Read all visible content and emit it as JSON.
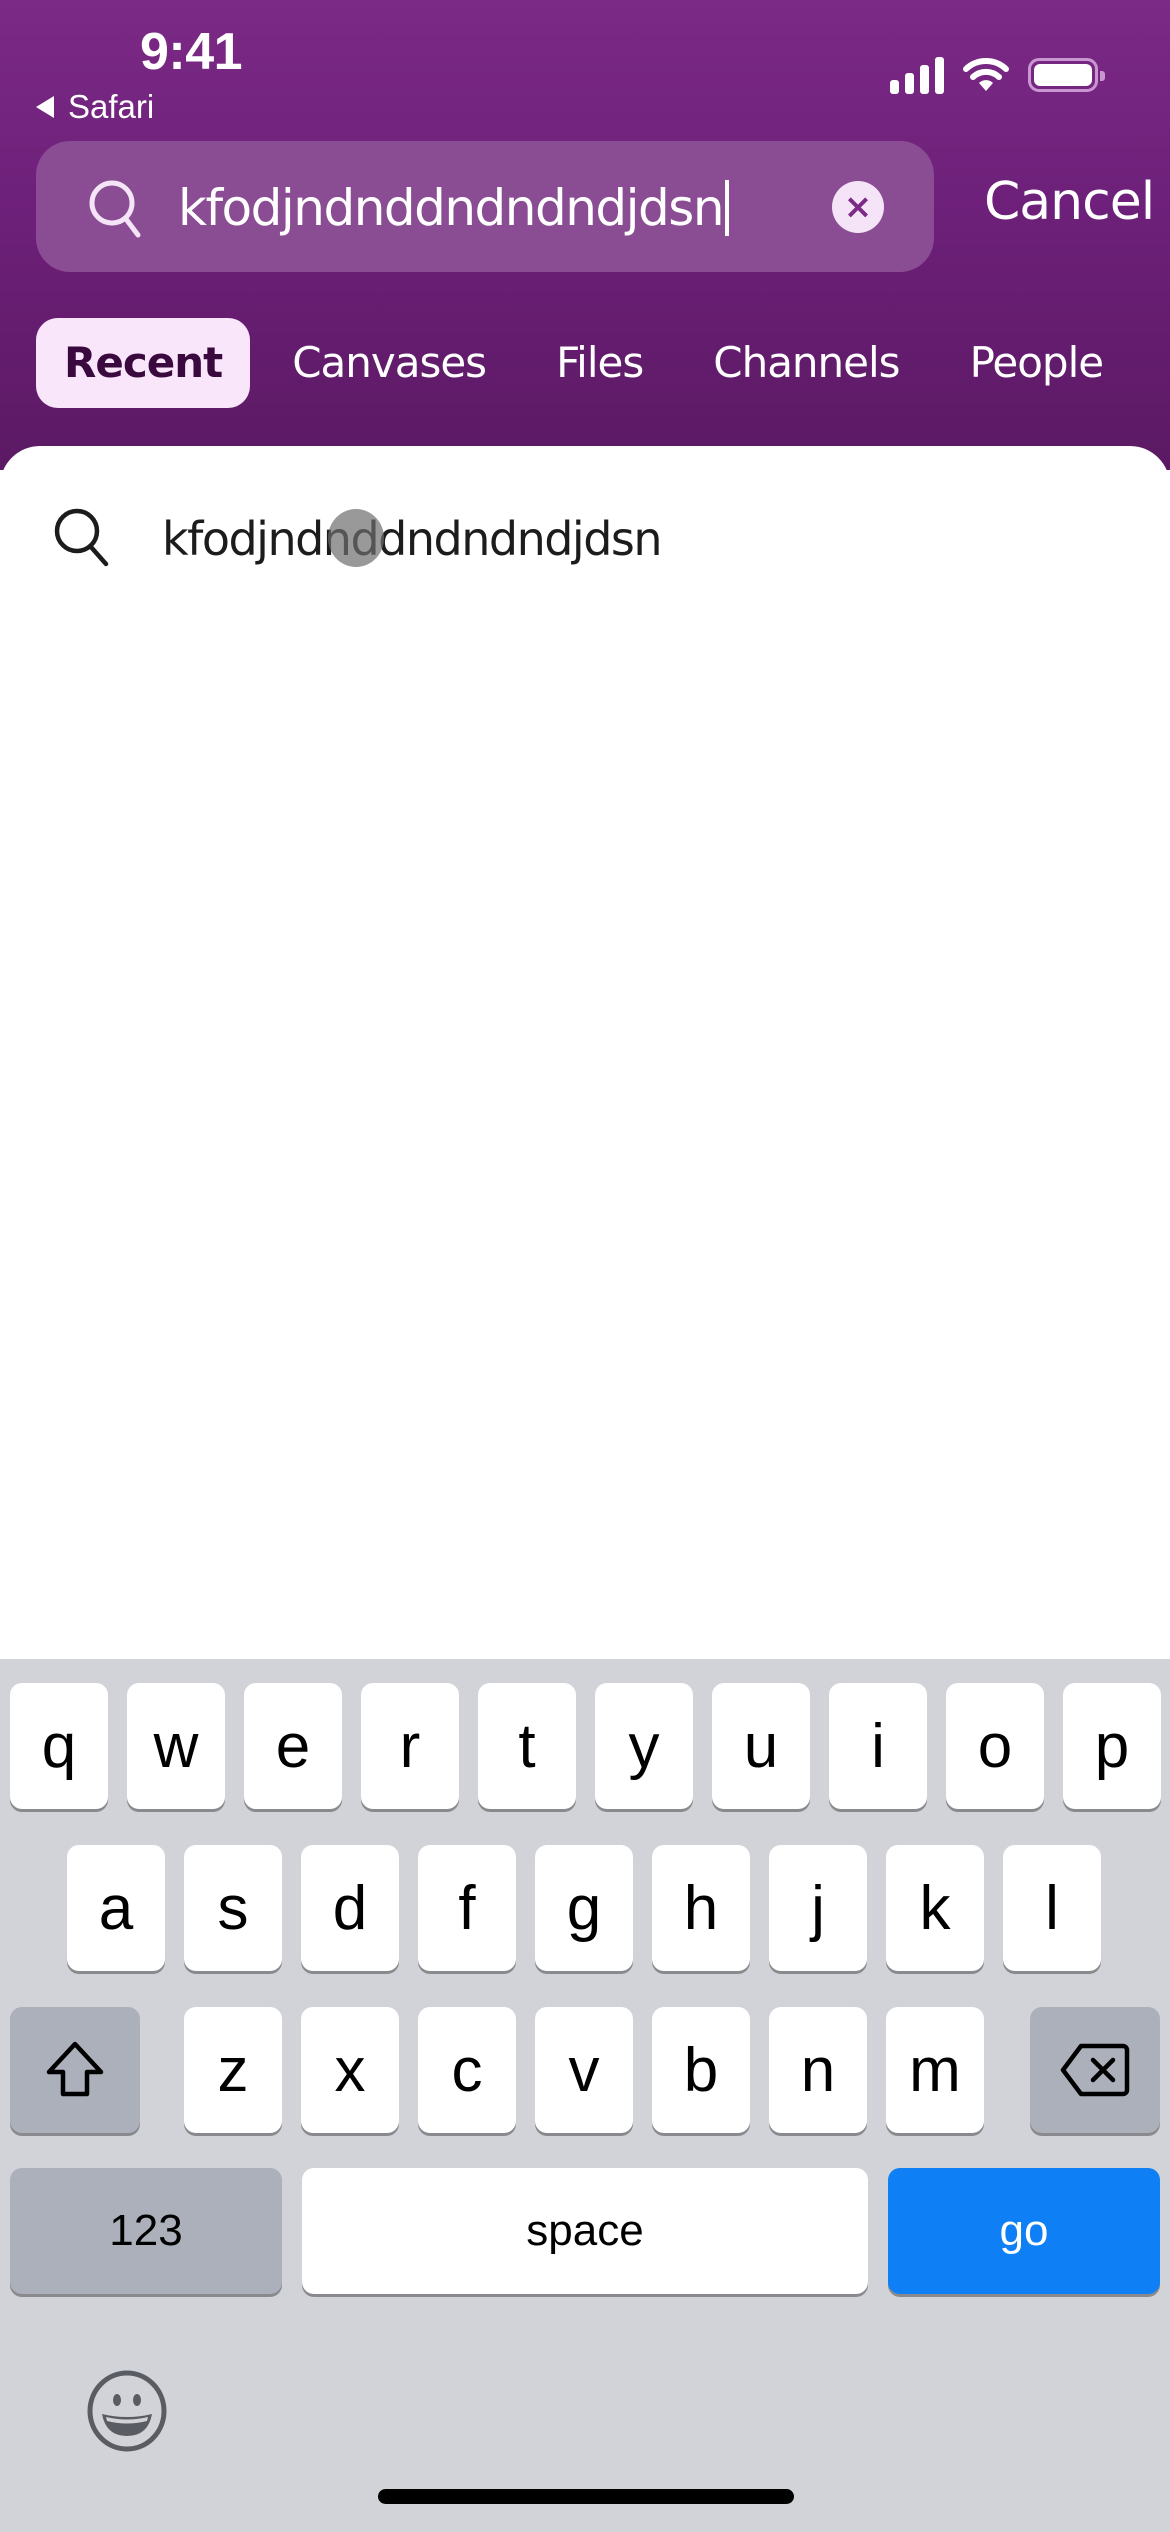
{
  "status_bar": {
    "time": "9:41",
    "back_app": "Safari",
    "icons": [
      "cellular-signal-icon",
      "wifi-icon",
      "battery-icon"
    ]
  },
  "search": {
    "query": "kfodjndnddndndndjdsn",
    "icon": "search-icon",
    "clear_icon": "clear-icon",
    "cancel_label": "Cancel"
  },
  "tabs": [
    {
      "label": "Recent",
      "active": true
    },
    {
      "label": "Canvases",
      "active": false
    },
    {
      "label": "Files",
      "active": false
    },
    {
      "label": "Channels",
      "active": false
    },
    {
      "label": "People",
      "active": false
    }
  ],
  "suggestions": [
    {
      "icon": "search-icon",
      "text": "kfodjndnddndndndjdsn"
    }
  ],
  "keyboard": {
    "row1": [
      "q",
      "w",
      "e",
      "r",
      "t",
      "y",
      "u",
      "i",
      "o",
      "p"
    ],
    "row2": [
      "a",
      "s",
      "d",
      "f",
      "g",
      "h",
      "j",
      "k",
      "l"
    ],
    "row3": [
      "z",
      "x",
      "c",
      "v",
      "b",
      "n",
      "m"
    ],
    "shift_icon": "shift-icon",
    "delete_icon": "delete-icon",
    "numbers_label": "123",
    "space_label": "space",
    "go_label": "go",
    "emoji_icon": "emoji-icon"
  },
  "colors": {
    "header_purple": "#7b2a85",
    "active_tab_bg": "#f9e6fa",
    "go_key_blue": "#0f7ff5"
  }
}
